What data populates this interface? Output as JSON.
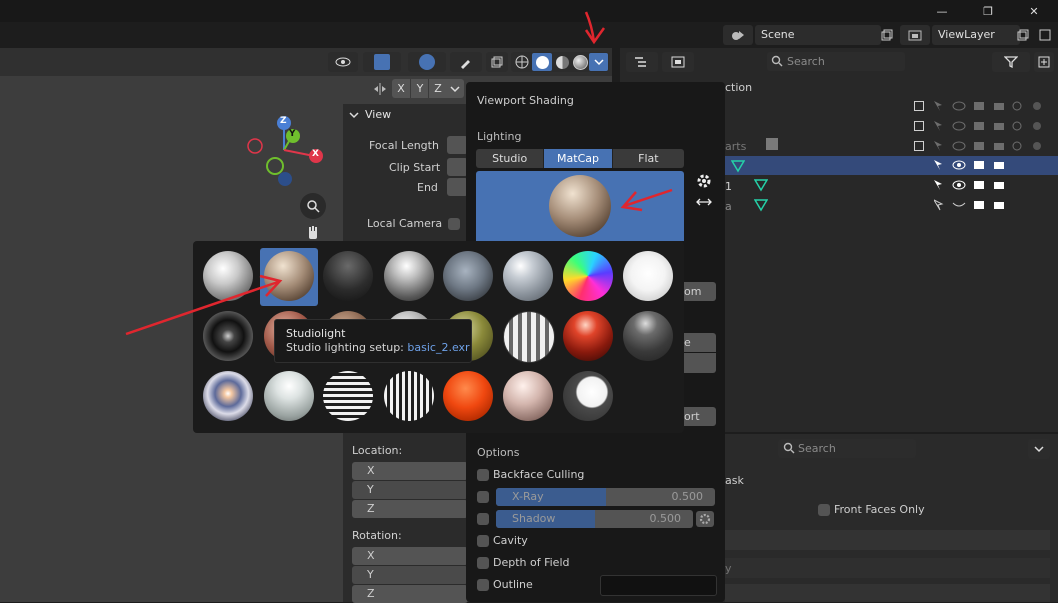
{
  "titlebar": {
    "minimize": "—",
    "maximize": "❐",
    "close": "✕"
  },
  "topbar": {
    "scene": "Scene",
    "viewlayer": "ViewLayer"
  },
  "viewport": {
    "gizmo": {
      "z": "Z",
      "y": "Y",
      "x": "X"
    },
    "axis_buttons": [
      "X",
      "Y",
      "Z"
    ]
  },
  "npanel": {
    "view_header": "View",
    "focal_length": "Focal Length",
    "clip_start": "Clip Start",
    "end": "End",
    "local_camera": "Local Camera",
    "location": "Location:",
    "rotation": "Rotation:",
    "loc_axes": [
      "X",
      "Y",
      "Z"
    ],
    "rot_axes": [
      "X",
      "Y",
      "Z"
    ]
  },
  "popover": {
    "title": "Viewport Shading",
    "lighting": "Lighting",
    "lighting_modes": [
      "Studio",
      "MatCap",
      "Flat"
    ],
    "lighting_active": "MatCap",
    "options": "Options",
    "backface_culling": "Backface Culling",
    "xray_label": "X-Ray",
    "xray_value": "0.500",
    "xray_fill": 0.5,
    "shadow_label": "Shadow",
    "shadow_value": "0.500",
    "shadow_fill": 0.5,
    "cavity": "Cavity",
    "depth_of_field": "Depth of Field",
    "outline": "Outline",
    "partial_btn1": "om",
    "partial_btn2": "e",
    "partial_btn3": "ort"
  },
  "tooltip": {
    "title": "Studiolight",
    "desc_prefix": "Studio lighting setup: ",
    "desc_file": "basic_2.exr"
  },
  "outliner": {
    "search_placeholder": "Search",
    "partial_collection": "ction",
    "partial_parts": "arts",
    "partial_1": "1",
    "partial_a": "a"
  },
  "properties": {
    "search_placeholder": "Search",
    "partial_ask": "ask",
    "front_faces_only": "Front Faces Only",
    "partial_y": "y"
  },
  "colors": {
    "accent": "#4772b3",
    "annotation_arrow": "#e0262e"
  }
}
